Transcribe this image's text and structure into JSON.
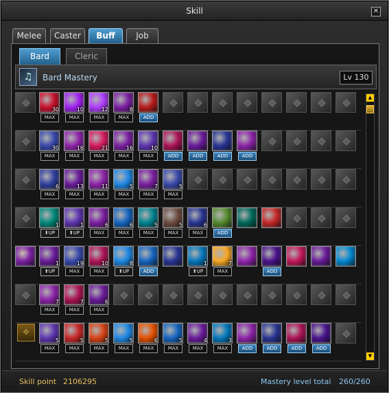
{
  "window": {
    "title": "Skill",
    "close": "✕"
  },
  "tabs": [
    "Melee",
    "Caster",
    "Buff",
    "Job"
  ],
  "subtabs": [
    "Bard",
    "Cleric"
  ],
  "mastery": {
    "name": "Bard Mastery",
    "level": "Lv 130"
  },
  "scroll": {
    "up": "▲",
    "down": "▼"
  },
  "footer": {
    "skill_point_label": "Skill point",
    "skill_point_value": "2106295",
    "mastery_total_label": "Mastery level total",
    "mastery_total_value": "260/260"
  },
  "rows": [
    {
      "category": "harp",
      "slots": [
        {
          "c": "#c8102e",
          "n": "30",
          "t": "MAX"
        },
        {
          "c": "#a020f0",
          "n": "10",
          "t": "MAX"
        },
        {
          "c": "#b03cff",
          "n": "12",
          "t": "MAX"
        },
        {
          "c": "#7b1fa2",
          "n": "8",
          "t": "MAX"
        },
        {
          "c": "#b71c1c",
          "t": "ADD"
        },
        {
          "e": 1
        },
        {
          "e": 1
        },
        {
          "e": 1
        },
        {
          "e": 1
        },
        {
          "e": 1
        },
        {
          "e": 1
        },
        {
          "e": 1
        },
        {
          "e": 1
        },
        {
          "e": 1
        }
      ]
    },
    {
      "category": "trumpet",
      "slots": [
        {
          "c": "#3949ab",
          "n": "30",
          "t": "MAX"
        },
        {
          "c": "#8e24aa",
          "n": "16",
          "t": "MAX"
        },
        {
          "c": "#d81b60",
          "n": "21",
          "t": "MAX"
        },
        {
          "c": "#7b1fa2",
          "n": "16",
          "t": "MAX"
        },
        {
          "c": "#5e35b1",
          "n": "10",
          "t": "MAX"
        },
        {
          "c": "#ad1457",
          "t": "ADD"
        },
        {
          "c": "#6a1b9a",
          "t": "ADD"
        },
        {
          "c": "#283593",
          "t": "ADD"
        },
        {
          "c": "#8e24aa",
          "t": "ADD"
        },
        {
          "e": 1
        },
        {
          "e": 1
        },
        {
          "e": 1
        },
        {
          "e": 1
        },
        {
          "e": 1
        }
      ]
    },
    {
      "category": "drum",
      "slots": [
        {
          "c": "#303f9f",
          "n": "6",
          "t": "MAX"
        },
        {
          "c": "#6a1b9a",
          "n": "13",
          "t": "MAX"
        },
        {
          "c": "#8e24aa",
          "n": "11",
          "t": "MAX"
        },
        {
          "c": "#1e88e5",
          "n": "5",
          "t": "MAX"
        },
        {
          "c": "#7b1fa2",
          "n": "7",
          "t": "MAX"
        },
        {
          "c": "#3949ab",
          "n": "5",
          "t": "MAX"
        },
        {
          "e": 1
        },
        {
          "e": 1
        },
        {
          "e": 1
        },
        {
          "e": 1
        },
        {
          "e": 1
        },
        {
          "e": 1
        },
        {
          "e": 1
        },
        {
          "e": 1
        }
      ]
    },
    {
      "category": "guitar",
      "slots": [
        {
          "c": "#00897b",
          "n": "1",
          "t": "⬆UP"
        },
        {
          "c": "#5e35b1",
          "n": "1",
          "t": "⬆UP"
        },
        {
          "c": "#7b1fa2",
          "n": "6",
          "t": "MAX"
        },
        {
          "c": "#1565c0",
          "n": "6",
          "t": "MAX"
        },
        {
          "c": "#00838f",
          "n": "5",
          "t": "MAX"
        },
        {
          "c": "#6d4c41",
          "n": "5",
          "t": "MAX"
        },
        {
          "c": "#283593",
          "n": "6",
          "t": "MAX"
        },
        {
          "c": "#558b2f",
          "t": "ADD"
        },
        {
          "c": "#00695c"
        },
        {
          "c": "#c62828"
        },
        {
          "e": 1
        },
        {
          "e": 1
        },
        {
          "e": 1
        },
        {
          "e": 1
        }
      ]
    },
    {
      "category": "lyre",
      "slots": [
        {
          "c": "#6a1b9a",
          "n": "1",
          "t": "⬆UP"
        },
        {
          "c": "#3949ab",
          "n": "19",
          "t": "MAX"
        },
        {
          "c": "#ad1457",
          "n": "10",
          "t": "MAX"
        },
        {
          "c": "#1e88e5",
          "n": "8",
          "t": "⬆UP"
        },
        {
          "c": "#1565c0",
          "t": "ADD"
        },
        {
          "c": "#283593"
        },
        {
          "c": "#0277bd",
          "n": "1",
          "t": "⬆UP"
        },
        {
          "c": "#f9a825",
          "n": "7",
          "t": "MAX"
        },
        {
          "c": "#8e24aa"
        },
        {
          "c": "#4a148c",
          "t": "ADD"
        },
        {
          "c": "#c2185b"
        },
        {
          "c": "#6a1b9a"
        },
        {
          "c": "#0288d1"
        },
        {
          "c": "#7b1fa2"
        }
      ]
    },
    {
      "category": "flute",
      "slots": [
        {
          "c": "#8e24aa",
          "n": "7",
          "t": "MAX"
        },
        {
          "c": "#ad1457",
          "n": "7",
          "t": "MAX"
        },
        {
          "c": "#6a1b9a",
          "n": "6",
          "t": "MAX"
        },
        {
          "e": 1
        },
        {
          "e": 1
        },
        {
          "e": 1
        },
        {
          "e": 1
        },
        {
          "e": 1
        },
        {
          "e": 1
        },
        {
          "e": 1
        },
        {
          "e": 1
        },
        {
          "e": 1
        },
        {
          "e": 1
        },
        {
          "e": 1
        }
      ]
    },
    {
      "category": "chime",
      "slots": [
        {
          "c": "#5e35b1",
          "n": "5",
          "t": "MAX"
        },
        {
          "c": "#c62828",
          "n": "5",
          "t": "MAX"
        },
        {
          "c": "#d84315",
          "n": "5",
          "t": "MAX"
        },
        {
          "c": "#1e88e5",
          "n": "5",
          "t": "MAX"
        },
        {
          "c": "#e65100",
          "n": "6",
          "t": "MAX"
        },
        {
          "c": "#1565c0",
          "n": "5",
          "t": "MAX"
        },
        {
          "c": "#6a1b9a",
          "n": "4",
          "t": "MAX"
        },
        {
          "c": "#0277bd",
          "n": "3",
          "t": "MAX"
        },
        {
          "c": "#8e24aa",
          "t": "ADD"
        },
        {
          "c": "#283593",
          "t": "ADD"
        },
        {
          "c": "#ad1457",
          "t": "ADD"
        },
        {
          "c": "#4a148c",
          "t": "ADD"
        },
        {
          "e": 1
        }
      ]
    }
  ]
}
